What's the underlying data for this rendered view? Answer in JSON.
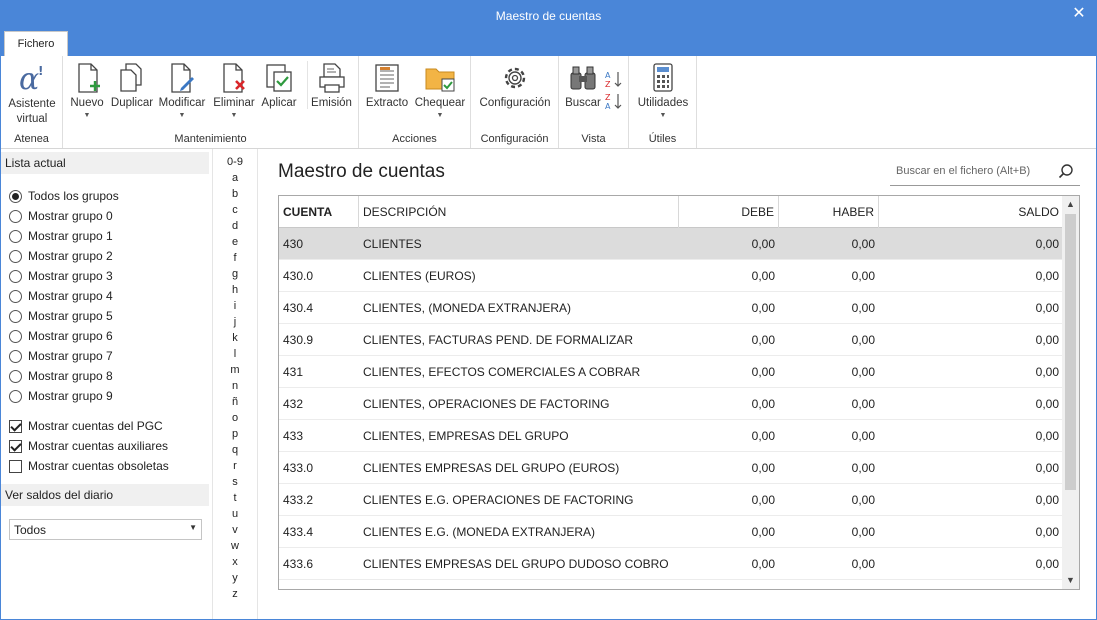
{
  "window": {
    "title": "Maestro de cuentas"
  },
  "tabs": [
    {
      "label": "Fichero"
    }
  ],
  "ribbon": {
    "groups": {
      "atenea": "Atenea",
      "mantenimiento": "Mantenimiento",
      "acciones": "Acciones",
      "configuracion": "Configuración",
      "vista": "Vista",
      "utiles": "Útiles"
    },
    "buttons": {
      "asistente": "Asistente\nvirtual",
      "nuevo": "Nuevo",
      "duplicar": "Duplicar",
      "modificar": "Modificar",
      "eliminar": "Eliminar",
      "aplicar": "Aplicar",
      "emision": "Emisión",
      "extracto": "Extracto",
      "chequear": "Chequear",
      "configuracion": "Configuración",
      "buscar": "Buscar",
      "utilidades": "Utilidades"
    }
  },
  "left": {
    "lista_header": "Lista actual",
    "radios": [
      "Todos los grupos",
      "Mostrar grupo 0",
      "Mostrar grupo 1",
      "Mostrar grupo 2",
      "Mostrar grupo 3",
      "Mostrar grupo 4",
      "Mostrar grupo 5",
      "Mostrar grupo 6",
      "Mostrar grupo 7",
      "Mostrar grupo 8",
      "Mostrar grupo 9"
    ],
    "selected_radio": 0,
    "checks": [
      {
        "label": "Mostrar cuentas del PGC",
        "checked": true
      },
      {
        "label": "Mostrar cuentas auxiliares",
        "checked": true
      },
      {
        "label": "Mostrar cuentas obsoletas",
        "checked": false
      }
    ],
    "saldos_header": "Ver saldos del diario",
    "saldos_value": "Todos"
  },
  "alphabet": [
    "0-9",
    "a",
    "b",
    "c",
    "d",
    "e",
    "f",
    "g",
    "h",
    "i",
    "j",
    "k",
    "l",
    "m",
    "n",
    "ñ",
    "o",
    "p",
    "q",
    "r",
    "s",
    "t",
    "u",
    "v",
    "w",
    "x",
    "y",
    "z"
  ],
  "main": {
    "title": "Maestro de cuentas",
    "search_placeholder": "Buscar en el fichero (Alt+B)"
  },
  "table": {
    "columns": [
      "CUENTA",
      "DESCRIPCIÓN",
      "DEBE",
      "HABER",
      "SALDO"
    ],
    "selected_row": 0,
    "rows": [
      [
        "430",
        "CLIENTES",
        "0,00",
        "0,00",
        "0,00"
      ],
      [
        "430.0",
        "CLIENTES (EUROS)",
        "0,00",
        "0,00",
        "0,00"
      ],
      [
        "430.4",
        "CLIENTES, (MONEDA EXTRANJERA)",
        "0,00",
        "0,00",
        "0,00"
      ],
      [
        "430.9",
        "CLIENTES, FACTURAS PEND. DE FORMALIZAR",
        "0,00",
        "0,00",
        "0,00"
      ],
      [
        "431",
        "CLIENTES, EFECTOS COMERCIALES A COBRAR",
        "0,00",
        "0,00",
        "0,00"
      ],
      [
        "432",
        "CLIENTES, OPERACIONES DE FACTORING",
        "0,00",
        "0,00",
        "0,00"
      ],
      [
        "433",
        "CLIENTES, EMPRESAS DEL GRUPO",
        "0,00",
        "0,00",
        "0,00"
      ],
      [
        "433.0",
        "CLIENTES EMPRESAS DEL GRUPO (EUROS)",
        "0,00",
        "0,00",
        "0,00"
      ],
      [
        "433.2",
        "CLIENTES E.G. OPERACIONES DE FACTORING",
        "0,00",
        "0,00",
        "0,00"
      ],
      [
        "433.4",
        "CLIENTES E.G. (MONEDA EXTRANJERA)",
        "0,00",
        "0,00",
        "0,00"
      ],
      [
        "433.6",
        "CLIENTES EMPRESAS DEL GRUPO DUDOSO COBRO",
        "0,00",
        "0,00",
        "0,00"
      ]
    ]
  }
}
